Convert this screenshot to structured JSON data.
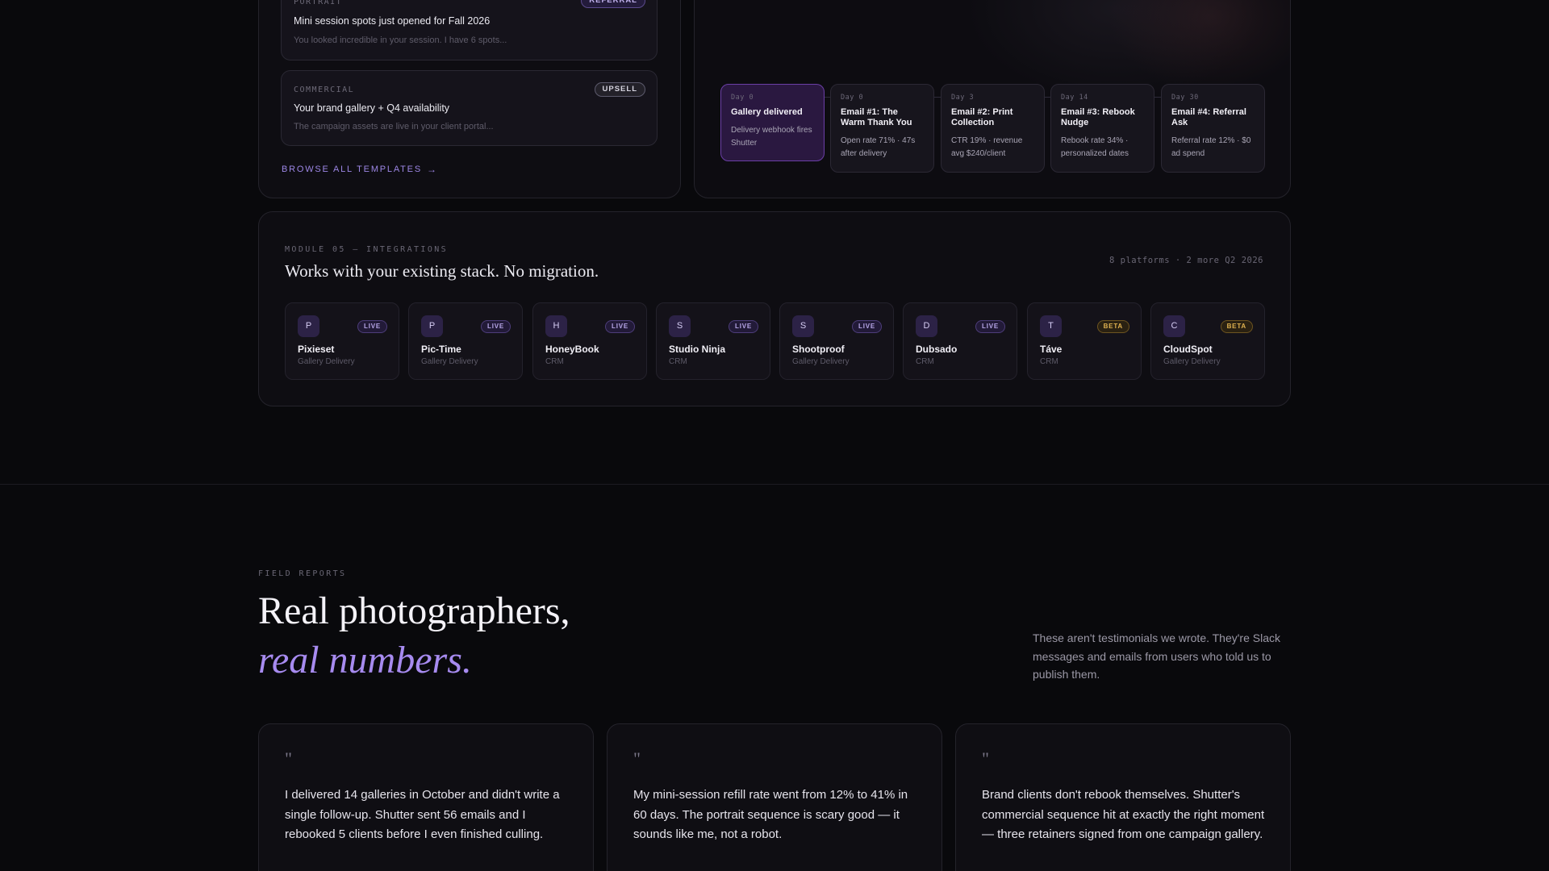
{
  "templates": {
    "items": [
      {
        "category": "PORTRAIT",
        "tag": "REFERRAL",
        "title": "Mini session spots just opened for Fall 2026",
        "snippet": "You looked incredible in your session. I have 6 spots..."
      },
      {
        "category": "COMMERCIAL",
        "tag": "UPSELL",
        "title": "Your brand gallery + Q4 availability",
        "snippet": "The campaign assets are live in your client portal..."
      }
    ],
    "browse_label": "BROWSE ALL TEMPLATES",
    "browse_icon": "arrow-right-icon"
  },
  "sequence": {
    "steps": [
      {
        "day": "Day 0",
        "title": "Gallery delivered",
        "desc": "Delivery webhook fires Shutter"
      },
      {
        "day": "Day 0",
        "title": "Email #1: The Warm Thank You",
        "desc": "Open rate 71% · 47s after delivery"
      },
      {
        "day": "Day 3",
        "title": "Email #2: Print Collection",
        "desc": "CTR 19% · revenue avg $240/client"
      },
      {
        "day": "Day 14",
        "title": "Email #3: Rebook Nudge",
        "desc": "Rebook rate 34% · personalized dates"
      },
      {
        "day": "Day 30",
        "title": "Email #4: Referral Ask",
        "desc": "Referral rate 12% · $0 ad spend"
      }
    ]
  },
  "integrations": {
    "eyebrow": "MODULE 05 — INTEGRATIONS",
    "title": "Works with your existing stack. No migration.",
    "meta": "8 platforms · 2 more Q2 2026",
    "items": [
      {
        "letter": "P",
        "status": "LIVE",
        "name": "Pixieset",
        "type": "Gallery Delivery"
      },
      {
        "letter": "P",
        "status": "LIVE",
        "name": "Pic-Time",
        "type": "Gallery Delivery"
      },
      {
        "letter": "H",
        "status": "LIVE",
        "name": "HoneyBook",
        "type": "CRM"
      },
      {
        "letter": "S",
        "status": "LIVE",
        "name": "Studio Ninja",
        "type": "CRM"
      },
      {
        "letter": "S",
        "status": "LIVE",
        "name": "Shootproof",
        "type": "Gallery Delivery"
      },
      {
        "letter": "D",
        "status": "LIVE",
        "name": "Dubsado",
        "type": "CRM"
      },
      {
        "letter": "T",
        "status": "BETA",
        "name": "Táve",
        "type": "CRM"
      },
      {
        "letter": "C",
        "status": "BETA",
        "name": "CloudSpot",
        "type": "Gallery Delivery"
      }
    ]
  },
  "field_reports": {
    "eyebrow": "FIELD REPORTS",
    "headline_1": "Real photographers,",
    "headline_2": "real numbers.",
    "side_text": "These aren't testimonials we wrote. They're Slack messages and emails from users who told us to publish them.",
    "quote_mark": "\"",
    "quotes": [
      "I delivered 14 galleries in October and didn't write a single follow-up. Shutter sent 56 emails and I rebooked 5 clients before I even finished culling.",
      "My mini-session refill rate went from 12% to 41% in 60 days. The portrait sequence is scary good — it sounds like me, not a robot.",
      "Brand clients don't rebook themselves. Shutter's commercial sequence hit at exactly the right moment — three retainers signed from one campaign gallery."
    ]
  },
  "colors": {
    "background": "#09090c",
    "accent": "#a78bf0",
    "live_badge": "#b9a8ea",
    "beta_badge": "#e0b250"
  }
}
